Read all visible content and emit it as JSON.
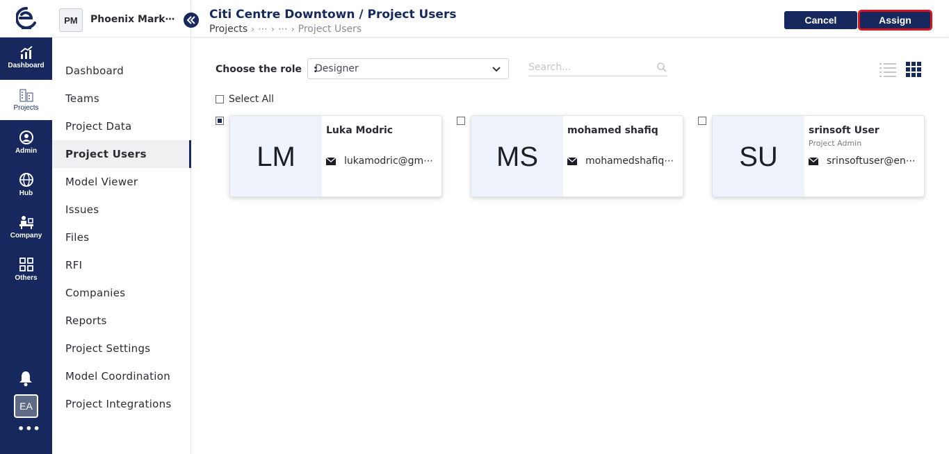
{
  "rail": {
    "items": [
      {
        "label": "Dashboard",
        "icon": "chart-icon"
      },
      {
        "label": "Projects",
        "icon": "buildings-icon"
      },
      {
        "label": "Admin",
        "icon": "user-circle-icon"
      },
      {
        "label": "Hub",
        "icon": "globe-icon"
      },
      {
        "label": "Company",
        "icon": "office-icon"
      },
      {
        "label": "Others",
        "icon": "grid-icon"
      }
    ],
    "avatar": "EA",
    "more": "•••"
  },
  "sidebar": {
    "project_badge": "PM",
    "project_name": "Phoenix Mark⋯",
    "items": [
      {
        "label": "Dashboard"
      },
      {
        "label": "Teams"
      },
      {
        "label": "Project Data"
      },
      {
        "label": "Project Users"
      },
      {
        "label": "Model Viewer"
      },
      {
        "label": "Issues"
      },
      {
        "label": "Files"
      },
      {
        "label": "RFI"
      },
      {
        "label": "Companies"
      },
      {
        "label": "Reports"
      },
      {
        "label": "Project Settings"
      },
      {
        "label": "Model Coordination"
      },
      {
        "label": "Project Integrations"
      }
    ],
    "active_index": 3
  },
  "header": {
    "title": "Citi Centre Downtown / Project Users",
    "breadcrumb": {
      "first": "Projects",
      "middle1": "⋯",
      "middle2": "⋯",
      "last": "Project Users"
    },
    "cancel_label": "Cancel",
    "assign_label": "Assign"
  },
  "filters": {
    "role_label": "Choose the role",
    "role_colon": ":",
    "role_value": "Designer",
    "search_placeholder": "Search..."
  },
  "select_all_label": "Select All",
  "users": [
    {
      "initials": "LM",
      "name": "Luka Modric",
      "role": "",
      "email": "lukamodric@gm⋯",
      "checked": true
    },
    {
      "initials": "MS",
      "name": "mohamed shafiq",
      "role": "",
      "email": "mohamedshafiq⋯",
      "checked": false
    },
    {
      "initials": "SU",
      "name": "srinsoft User",
      "role": "Project Admin",
      "email": "srinsoftuser@en⋯",
      "checked": false
    }
  ],
  "colors": {
    "brand": "#16285e",
    "accent_outline": "#d4161c",
    "avatar_bg": "#eef2fa"
  }
}
